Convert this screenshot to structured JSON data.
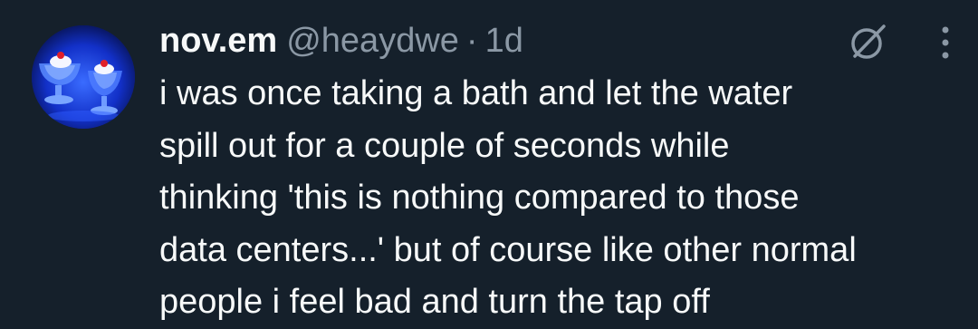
{
  "tweet": {
    "display_name": "nov.em",
    "handle": "@heaydwe",
    "separator": "·",
    "time": "1d",
    "text": "i was once taking a bath and let the water\nspill out for a couple of seconds while\nthinking 'this is nothing compared to those\ndata centers...' but of course like other normal\npeople i feel bad and turn the tap off"
  },
  "icons": {
    "grok": "grok-icon",
    "more": "more-options-icon"
  },
  "colors": {
    "background": "#15202b",
    "text_primary": "#f7f9f9",
    "text_secondary": "#8b98a5"
  }
}
